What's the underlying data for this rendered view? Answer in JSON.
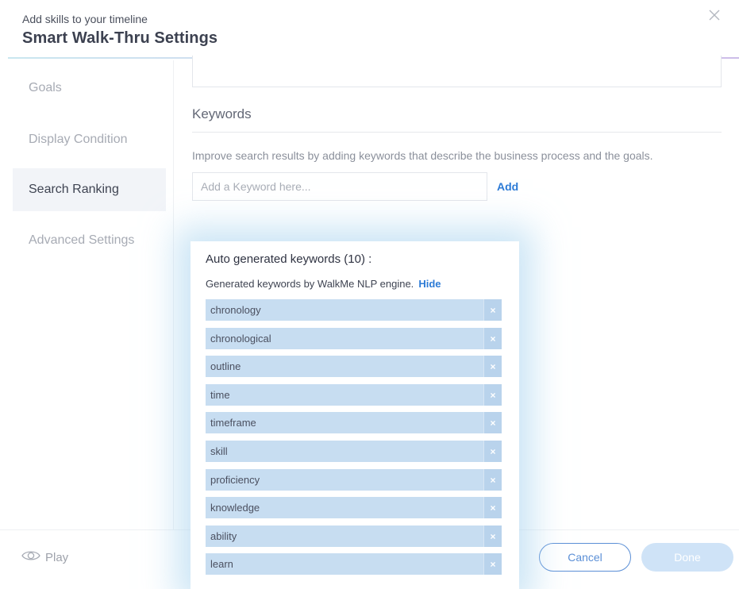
{
  "header": {
    "subtitle": "Add skills to your timeline",
    "title": "Smart Walk-Thru Settings",
    "close_icon": "close-icon"
  },
  "sidebar": {
    "items": [
      {
        "label": "Goals",
        "active": false
      },
      {
        "label": "Display Condition",
        "active": false
      },
      {
        "label": "Search Ranking",
        "active": true
      },
      {
        "label": "Advanced Settings",
        "active": false
      }
    ]
  },
  "keywords": {
    "heading": "Keywords",
    "description": "Improve search results by adding keywords that describe the business process and the goals.",
    "input_placeholder": "Add a Keyword here...",
    "input_value": "",
    "add_label": "Add"
  },
  "auto_keywords": {
    "title": "Auto generated keywords (10) :",
    "subtitle": "Generated keywords by WalkMe NLP engine.",
    "hide_label": "Hide",
    "remove_glyph": "×",
    "items": [
      "chronology",
      "chronological",
      "outline",
      "time",
      "timeframe",
      "skill",
      "proficiency",
      "knowledge",
      "ability",
      "learn"
    ]
  },
  "footer": {
    "play_label": "Play",
    "play_icon": "eye-icon",
    "cancel_label": "Cancel",
    "done_label": "Done"
  },
  "colors": {
    "accent": "#2d7bd6",
    "chip_bg": "#c7ddf1",
    "active_nav_bg": "#f2f4f8",
    "done_disabled": "#cfe3f7"
  }
}
